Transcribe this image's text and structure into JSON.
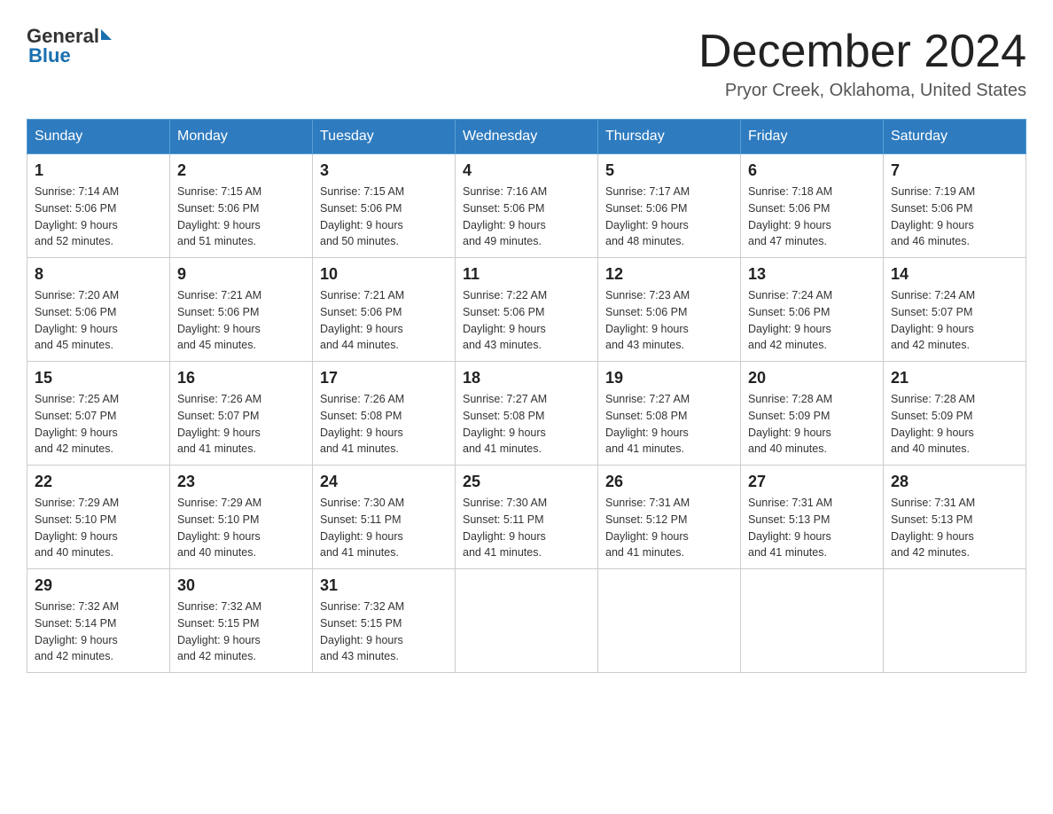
{
  "header": {
    "logo_general": "General",
    "logo_blue": "Blue",
    "title": "December 2024",
    "subtitle": "Pryor Creek, Oklahoma, United States"
  },
  "weekdays": [
    "Sunday",
    "Monday",
    "Tuesday",
    "Wednesday",
    "Thursday",
    "Friday",
    "Saturday"
  ],
  "weeks": [
    [
      {
        "day": "1",
        "sunrise": "7:14 AM",
        "sunset": "5:06 PM",
        "daylight": "9 hours and 52 minutes."
      },
      {
        "day": "2",
        "sunrise": "7:15 AM",
        "sunset": "5:06 PM",
        "daylight": "9 hours and 51 minutes."
      },
      {
        "day": "3",
        "sunrise": "7:15 AM",
        "sunset": "5:06 PM",
        "daylight": "9 hours and 50 minutes."
      },
      {
        "day": "4",
        "sunrise": "7:16 AM",
        "sunset": "5:06 PM",
        "daylight": "9 hours and 49 minutes."
      },
      {
        "day": "5",
        "sunrise": "7:17 AM",
        "sunset": "5:06 PM",
        "daylight": "9 hours and 48 minutes."
      },
      {
        "day": "6",
        "sunrise": "7:18 AM",
        "sunset": "5:06 PM",
        "daylight": "9 hours and 47 minutes."
      },
      {
        "day": "7",
        "sunrise": "7:19 AM",
        "sunset": "5:06 PM",
        "daylight": "9 hours and 46 minutes."
      }
    ],
    [
      {
        "day": "8",
        "sunrise": "7:20 AM",
        "sunset": "5:06 PM",
        "daylight": "9 hours and 45 minutes."
      },
      {
        "day": "9",
        "sunrise": "7:21 AM",
        "sunset": "5:06 PM",
        "daylight": "9 hours and 45 minutes."
      },
      {
        "day": "10",
        "sunrise": "7:21 AM",
        "sunset": "5:06 PM",
        "daylight": "9 hours and 44 minutes."
      },
      {
        "day": "11",
        "sunrise": "7:22 AM",
        "sunset": "5:06 PM",
        "daylight": "9 hours and 43 minutes."
      },
      {
        "day": "12",
        "sunrise": "7:23 AM",
        "sunset": "5:06 PM",
        "daylight": "9 hours and 43 minutes."
      },
      {
        "day": "13",
        "sunrise": "7:24 AM",
        "sunset": "5:06 PM",
        "daylight": "9 hours and 42 minutes."
      },
      {
        "day": "14",
        "sunrise": "7:24 AM",
        "sunset": "5:07 PM",
        "daylight": "9 hours and 42 minutes."
      }
    ],
    [
      {
        "day": "15",
        "sunrise": "7:25 AM",
        "sunset": "5:07 PM",
        "daylight": "9 hours and 42 minutes."
      },
      {
        "day": "16",
        "sunrise": "7:26 AM",
        "sunset": "5:07 PM",
        "daylight": "9 hours and 41 minutes."
      },
      {
        "day": "17",
        "sunrise": "7:26 AM",
        "sunset": "5:08 PM",
        "daylight": "9 hours and 41 minutes."
      },
      {
        "day": "18",
        "sunrise": "7:27 AM",
        "sunset": "5:08 PM",
        "daylight": "9 hours and 41 minutes."
      },
      {
        "day": "19",
        "sunrise": "7:27 AM",
        "sunset": "5:08 PM",
        "daylight": "9 hours and 41 minutes."
      },
      {
        "day": "20",
        "sunrise": "7:28 AM",
        "sunset": "5:09 PM",
        "daylight": "9 hours and 40 minutes."
      },
      {
        "day": "21",
        "sunrise": "7:28 AM",
        "sunset": "5:09 PM",
        "daylight": "9 hours and 40 minutes."
      }
    ],
    [
      {
        "day": "22",
        "sunrise": "7:29 AM",
        "sunset": "5:10 PM",
        "daylight": "9 hours and 40 minutes."
      },
      {
        "day": "23",
        "sunrise": "7:29 AM",
        "sunset": "5:10 PM",
        "daylight": "9 hours and 40 minutes."
      },
      {
        "day": "24",
        "sunrise": "7:30 AM",
        "sunset": "5:11 PM",
        "daylight": "9 hours and 41 minutes."
      },
      {
        "day": "25",
        "sunrise": "7:30 AM",
        "sunset": "5:11 PM",
        "daylight": "9 hours and 41 minutes."
      },
      {
        "day": "26",
        "sunrise": "7:31 AM",
        "sunset": "5:12 PM",
        "daylight": "9 hours and 41 minutes."
      },
      {
        "day": "27",
        "sunrise": "7:31 AM",
        "sunset": "5:13 PM",
        "daylight": "9 hours and 41 minutes."
      },
      {
        "day": "28",
        "sunrise": "7:31 AM",
        "sunset": "5:13 PM",
        "daylight": "9 hours and 42 minutes."
      }
    ],
    [
      {
        "day": "29",
        "sunrise": "7:32 AM",
        "sunset": "5:14 PM",
        "daylight": "9 hours and 42 minutes."
      },
      {
        "day": "30",
        "sunrise": "7:32 AM",
        "sunset": "5:15 PM",
        "daylight": "9 hours and 42 minutes."
      },
      {
        "day": "31",
        "sunrise": "7:32 AM",
        "sunset": "5:15 PM",
        "daylight": "9 hours and 43 minutes."
      },
      null,
      null,
      null,
      null
    ]
  ],
  "labels": {
    "sunrise": "Sunrise:",
    "sunset": "Sunset:",
    "daylight": "Daylight:"
  }
}
